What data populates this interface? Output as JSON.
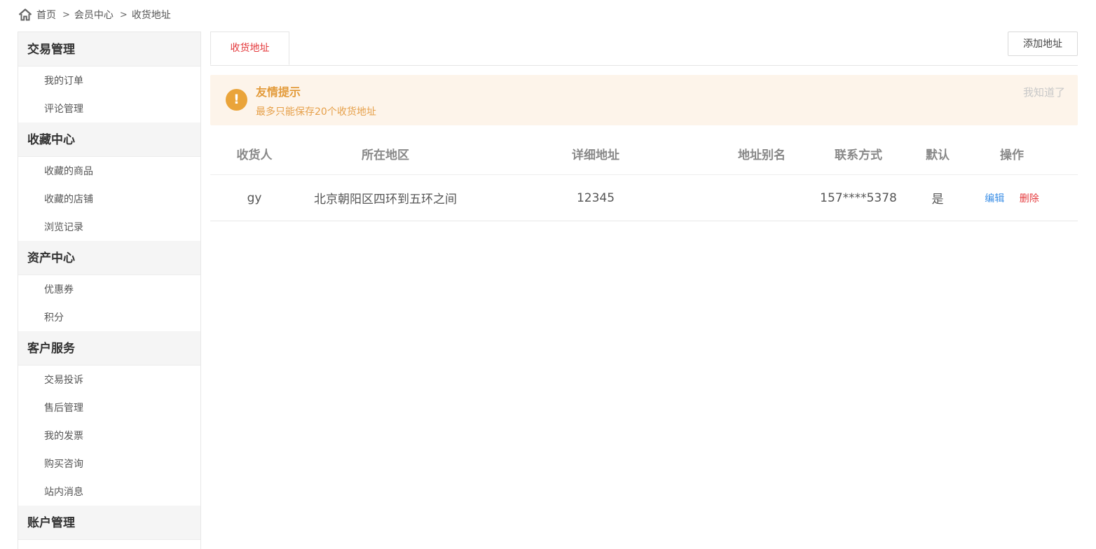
{
  "breadcrumb": {
    "home": "首页",
    "separator": ">",
    "member": "会员中心",
    "current": "收货地址",
    "icon": "home-icon"
  },
  "sidebar": {
    "groups": [
      {
        "title": "交易管理",
        "items": [
          "我的订单",
          "评论管理"
        ]
      },
      {
        "title": "收藏中心",
        "items": [
          "收藏的商品",
          "收藏的店铺",
          "浏览记录"
        ]
      },
      {
        "title": "资产中心",
        "items": [
          "优惠券",
          "积分"
        ]
      },
      {
        "title": "客户服务",
        "items": [
          "交易投诉",
          "售后管理",
          "我的发票",
          "购买咨询",
          "站内消息"
        ]
      },
      {
        "title": "账户管理",
        "items": []
      }
    ]
  },
  "main": {
    "tab_label": "收货地址",
    "add_button": "添加地址",
    "notice": {
      "title": "友情提示",
      "text": "最多只能保存20个收货地址",
      "ack": "我知道了",
      "icon_glyph": "!",
      "icon": "warning-icon"
    },
    "table": {
      "headers": {
        "receiver": "收货人",
        "region": "所在地区",
        "detail": "详细地址",
        "alias": "地址别名",
        "contact": "联系方式",
        "default": "默认",
        "actions": "操作"
      },
      "rows": [
        {
          "receiver": "gy",
          "region": "北京朝阳区四环到五环之间",
          "detail": "12345",
          "alias": "",
          "contact": "157****5378",
          "default": "是",
          "edit": "编辑",
          "delete": "删除"
        }
      ]
    }
  },
  "colors": {
    "accent_red": "#e4393c",
    "link_blue": "#3a8ee6",
    "warn_orange": "#eaa43a",
    "notice_bg": "#fdf4ea"
  }
}
